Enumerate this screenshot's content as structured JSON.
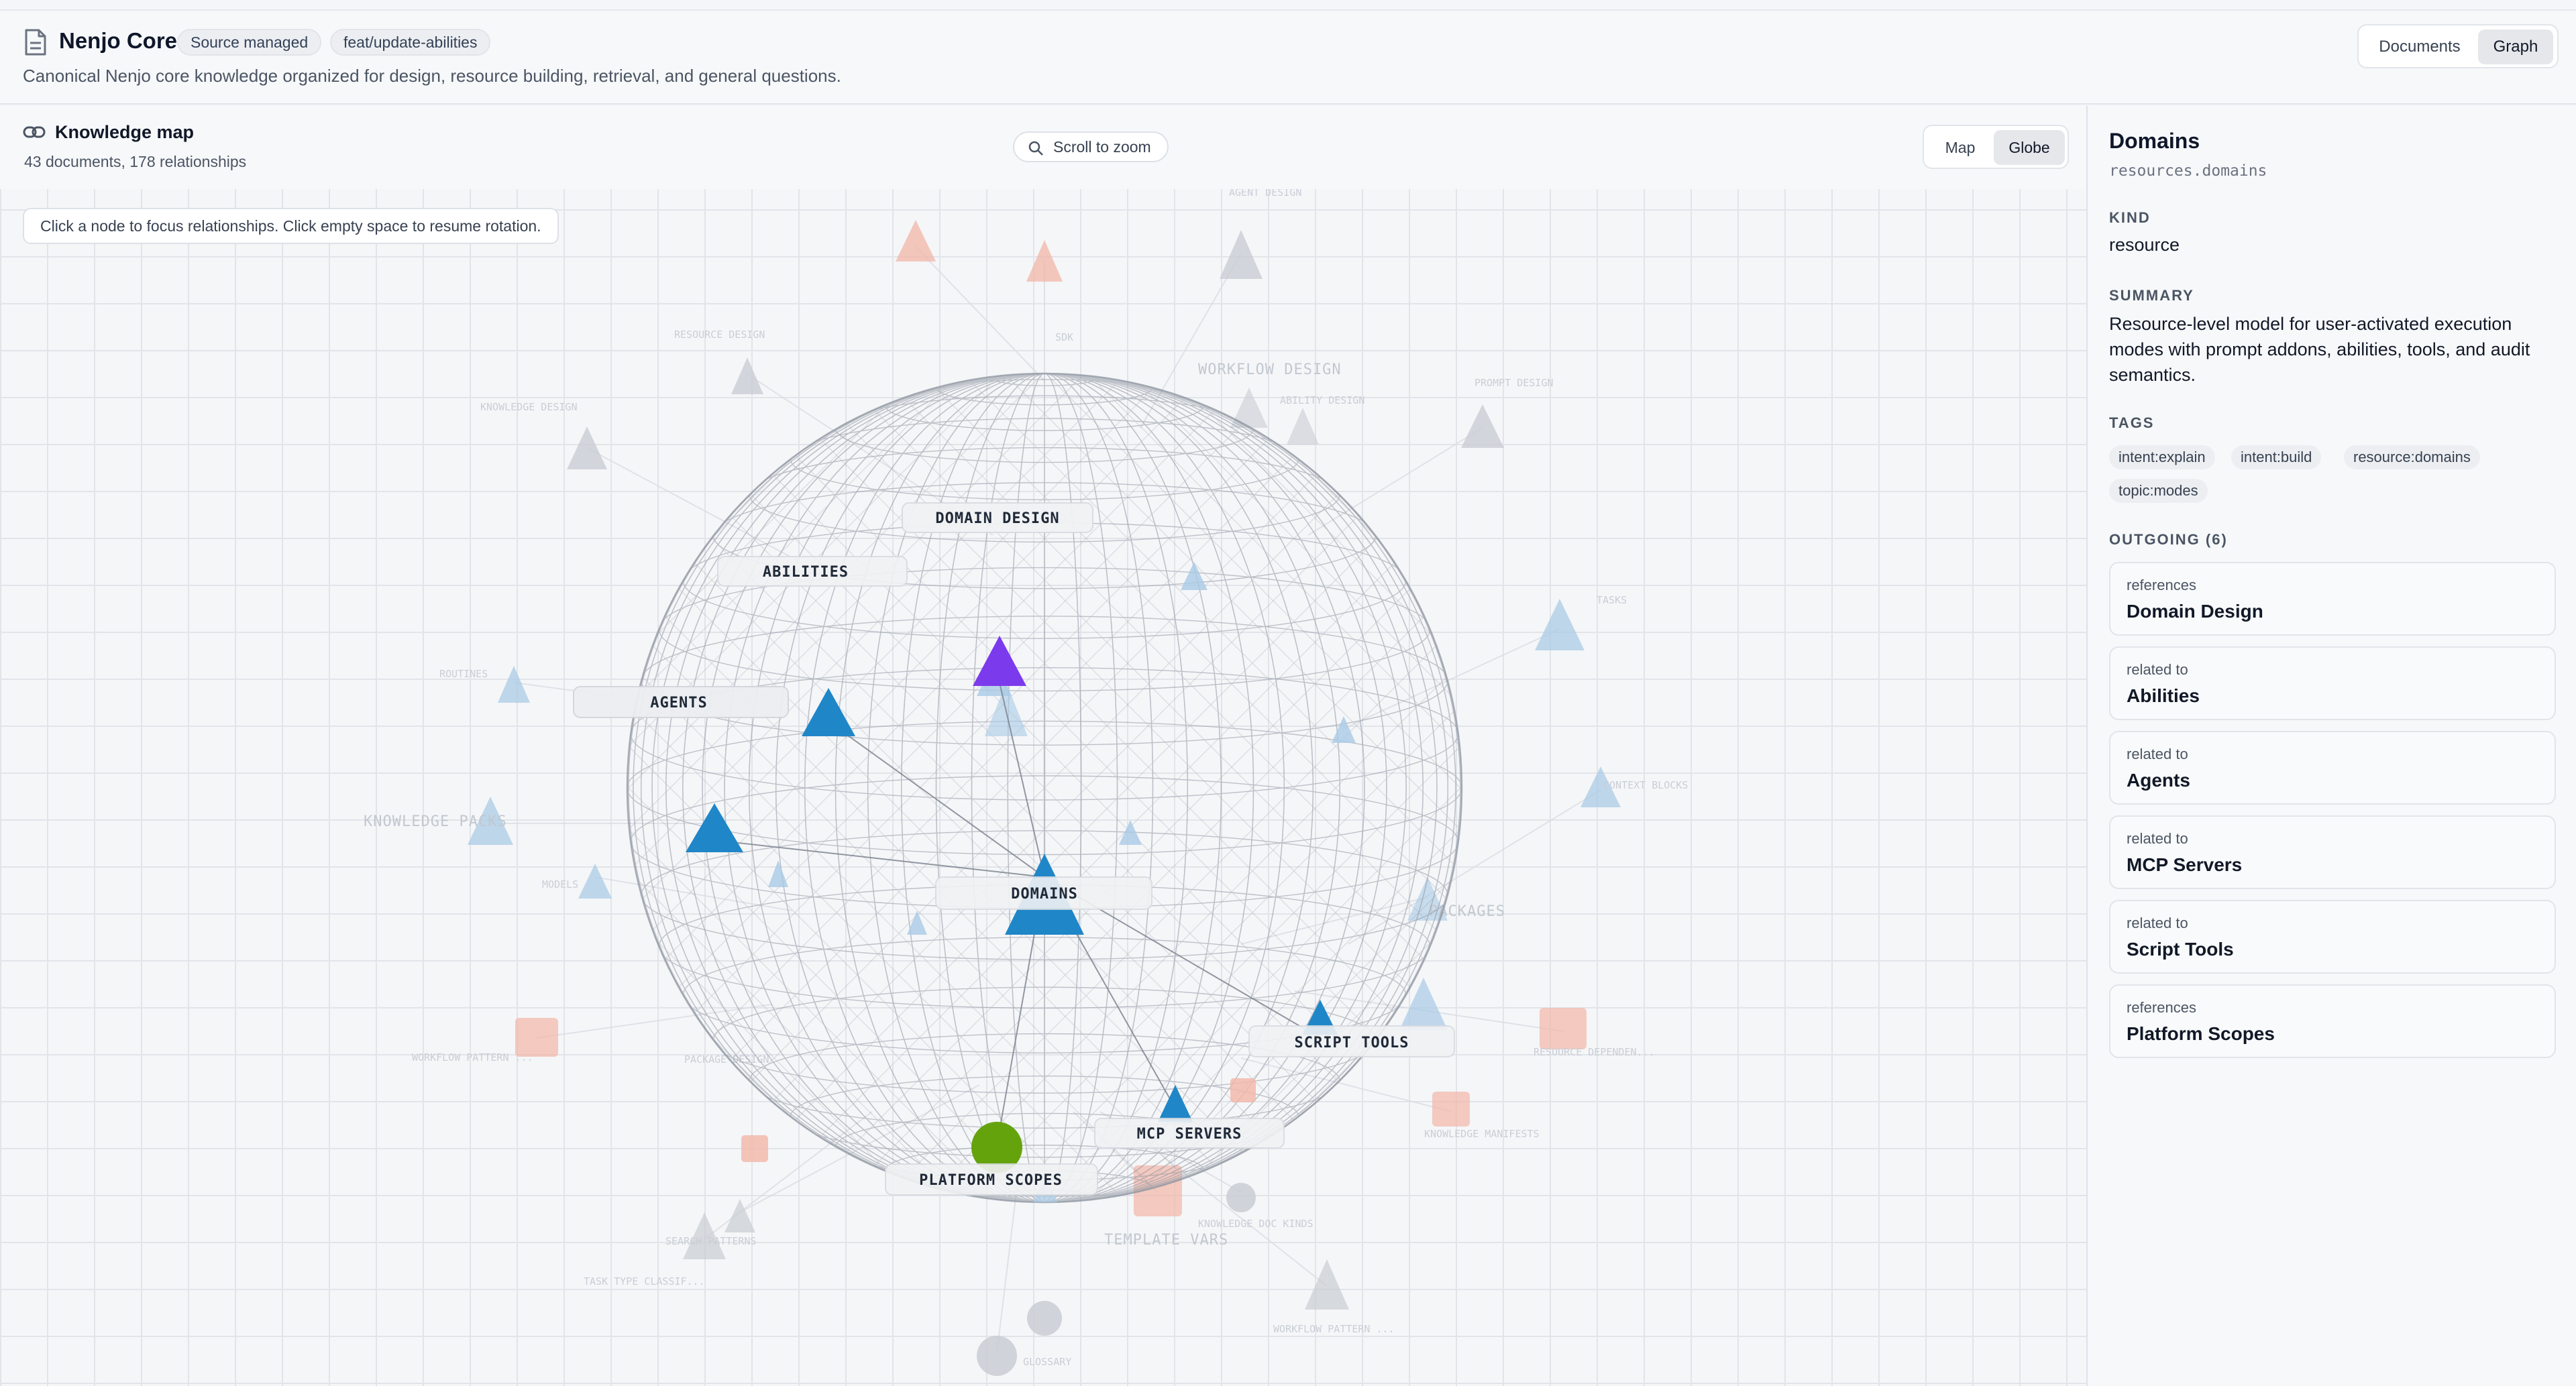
{
  "header": {
    "title": "Nenjo Core",
    "badge_source": "Source managed",
    "badge_branch": "feat/update-abilities",
    "description": "Canonical Nenjo core knowledge organized for design, resource building, retrieval, and general questions.",
    "view_tabs": {
      "documents": "Documents",
      "graph": "Graph",
      "selected": "Graph"
    }
  },
  "map": {
    "title": "Knowledge map",
    "subtitle": "43 documents, 178 relationships",
    "zoom_hint": "Scroll to zoom",
    "mode_map": "Map",
    "mode_globe": "Globe",
    "mode_selected": "Globe",
    "help": "Click a node to focus relationships. Click empty space to resume rotation."
  },
  "graph": {
    "focused": [
      "DOMAIN DESIGN",
      "ABILITIES",
      "AGENTS",
      "DOMAINS",
      "SCRIPT TOOLS",
      "MCP SERVERS",
      "PLATFORM SCOPES"
    ],
    "background": [
      "AGENT DESIGN",
      "RESOURCE DESIGN",
      "WORKFLOW DESIGN",
      "PROMPT DESIGN",
      "KNOWLEDGE DESIGN",
      "ROUTINES",
      "TASKS",
      "KNOWLEDGE PACKS",
      "CONTEXT BLOCKS",
      "PACKAGES",
      "WORKFLOW PATTERN ...",
      "RESOURCE DEPENDEN...",
      "KNOWLEDGE MANIFESTS",
      "TEMPLATE VARS",
      "TASK TYPE CLASSIF...",
      "WORKFLOW PATTERN ...",
      "SEARCH PATTERNS",
      "MODELS",
      "GLOSSARY",
      "ABILITY DESIGN",
      "KNOWLEDGE DOC KINDS",
      "PACKAGE DESIGN",
      "SDK"
    ],
    "colors": {
      "resource": "#1f86c8",
      "design": "#7c3aed",
      "scope": "#65a30d",
      "faded_blue": "#a9cbe6",
      "faded_red": "#f2b6a8",
      "faded_gray": "#c9cdd3"
    }
  },
  "detail": {
    "title": "Domains",
    "key": "resources.domains",
    "kind_label": "KIND",
    "kind": "resource",
    "summary_label": "SUMMARY",
    "summary": "Resource-level model for user-activated execution modes with prompt addons, abilities, tools, and audit semantics.",
    "tags_label": "TAGS",
    "tags": [
      "intent:explain",
      "intent:build",
      "resource:domains",
      "topic:modes"
    ],
    "outgoing_label": "OUTGOING (6)",
    "outgoing": [
      {
        "type": "references",
        "target": "Domain Design"
      },
      {
        "type": "related to",
        "target": "Abilities"
      },
      {
        "type": "related to",
        "target": "Agents"
      },
      {
        "type": "related to",
        "target": "MCP Servers"
      },
      {
        "type": "related to",
        "target": "Script Tools"
      },
      {
        "type": "references",
        "target": "Platform Scopes"
      }
    ]
  }
}
